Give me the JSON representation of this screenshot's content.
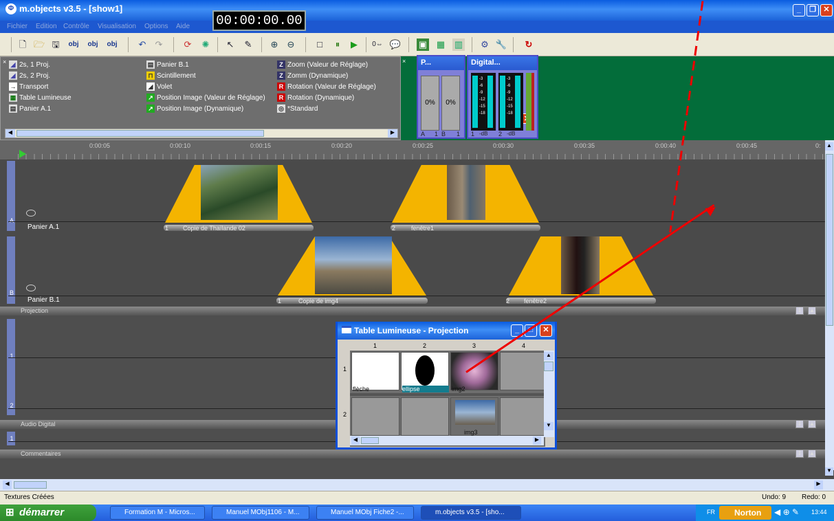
{
  "window": {
    "title": "m.objects v3.5 - [show1]",
    "logo": "m.objects-logo-icon",
    "timecode": "00:00:00.00"
  },
  "menu": [
    "Fichier",
    "Edition",
    "Contrôle",
    "Visualisation",
    "Options",
    "Aide"
  ],
  "toolbar": {
    "icons": [
      "new-icon",
      "open-icon",
      "save-icon",
      "obj-add-icon",
      "obj2-icon",
      "obj3-icon",
      "undo-icon",
      "redo-icon",
      "refresh-icon",
      "cycle-icon",
      "pointer-icon",
      "pen-icon",
      "zoom-in-icon",
      "zoom-out-icon",
      "stop-icon",
      "pause-icon",
      "play-icon",
      "position-icon",
      "comment-icon",
      "proj-view-icon",
      "proj-icon",
      "table-icon",
      "tools-icon",
      "wrench-icon",
      "loop-icon"
    ],
    "obj_labels": [
      "obj",
      "obj",
      "obj"
    ]
  },
  "library": {
    "col1": [
      "2s, 1 Proj.",
      "2s, 2 Proj.",
      "Transport",
      "Table Lumineuse",
      "Panier A.1"
    ],
    "col2": [
      "Panier B.1",
      "Scintillement",
      "Volet",
      "Position Image (Valeur de Réglage)",
      "Position Image (Dynamique)"
    ],
    "col3": [
      "Zoom (Valeur de Réglage)",
      "Zomm (Dynamique)",
      "Rotation (Valeur de Réglage)",
      "Rotation (Dynamique)",
      "*Standard"
    ]
  },
  "meter_p": {
    "title": "P...",
    "left": "0%",
    "right": "0%",
    "labelA": "A",
    "labelA_num": "1",
    "labelB": "B",
    "labelB_num": "1"
  },
  "meter_digital": {
    "title": "Digital...",
    "scale": [
      "-3",
      "-6",
      "-9",
      "-12",
      "-15",
      "-18"
    ],
    "ch1": "1",
    "ch2": "2",
    "unit": "-dB"
  },
  "ruler": {
    "ticks": [
      "0:00:05",
      "0:00:10",
      "0:00:15",
      "0:00:20",
      "0:00:25",
      "0:00:30",
      "0:00:35",
      "0:00:40",
      "0:00:45",
      "0:"
    ]
  },
  "tracks": {
    "a": {
      "rail": "A",
      "label": "Panier A.1",
      "clip1": {
        "num": "1",
        "name": "Copie de Thaïlande 02"
      },
      "clip2": {
        "num": "2",
        "name": "fenêtre1"
      }
    },
    "b": {
      "rail": "B",
      "label": "Panier B.1",
      "clip1": {
        "num": "1",
        "name": "Copie de img4"
      },
      "clip2": {
        "num": "2",
        "name": "fenêtre2"
      }
    }
  },
  "sections": {
    "projection": "Projection",
    "audio": "Audio Digital",
    "comments": "Commentaires"
  },
  "audio_rows": [
    "1",
    "2"
  ],
  "comment_row": "1",
  "lightbox": {
    "title": "Table Lumineuse - Projection",
    "cols": [
      "1",
      "2",
      "3",
      "4"
    ],
    "rows": [
      "1",
      "2"
    ],
    "items": [
      "flèche",
      "ellipse",
      "img2",
      "img3"
    ]
  },
  "status": {
    "left": "Textures Créées",
    "undo": "Undo: 9",
    "redo": "Redo: 0"
  },
  "taskbar": {
    "start": "démarrer",
    "buttons": [
      "Formation M - Micros...",
      "Manuel MObj1106 - M...",
      "Manuel MObj Fiche2 -...",
      "m.objects v3.5 - [sho..."
    ],
    "lang": "FR",
    "norton": "Norton",
    "time": "13:44"
  }
}
